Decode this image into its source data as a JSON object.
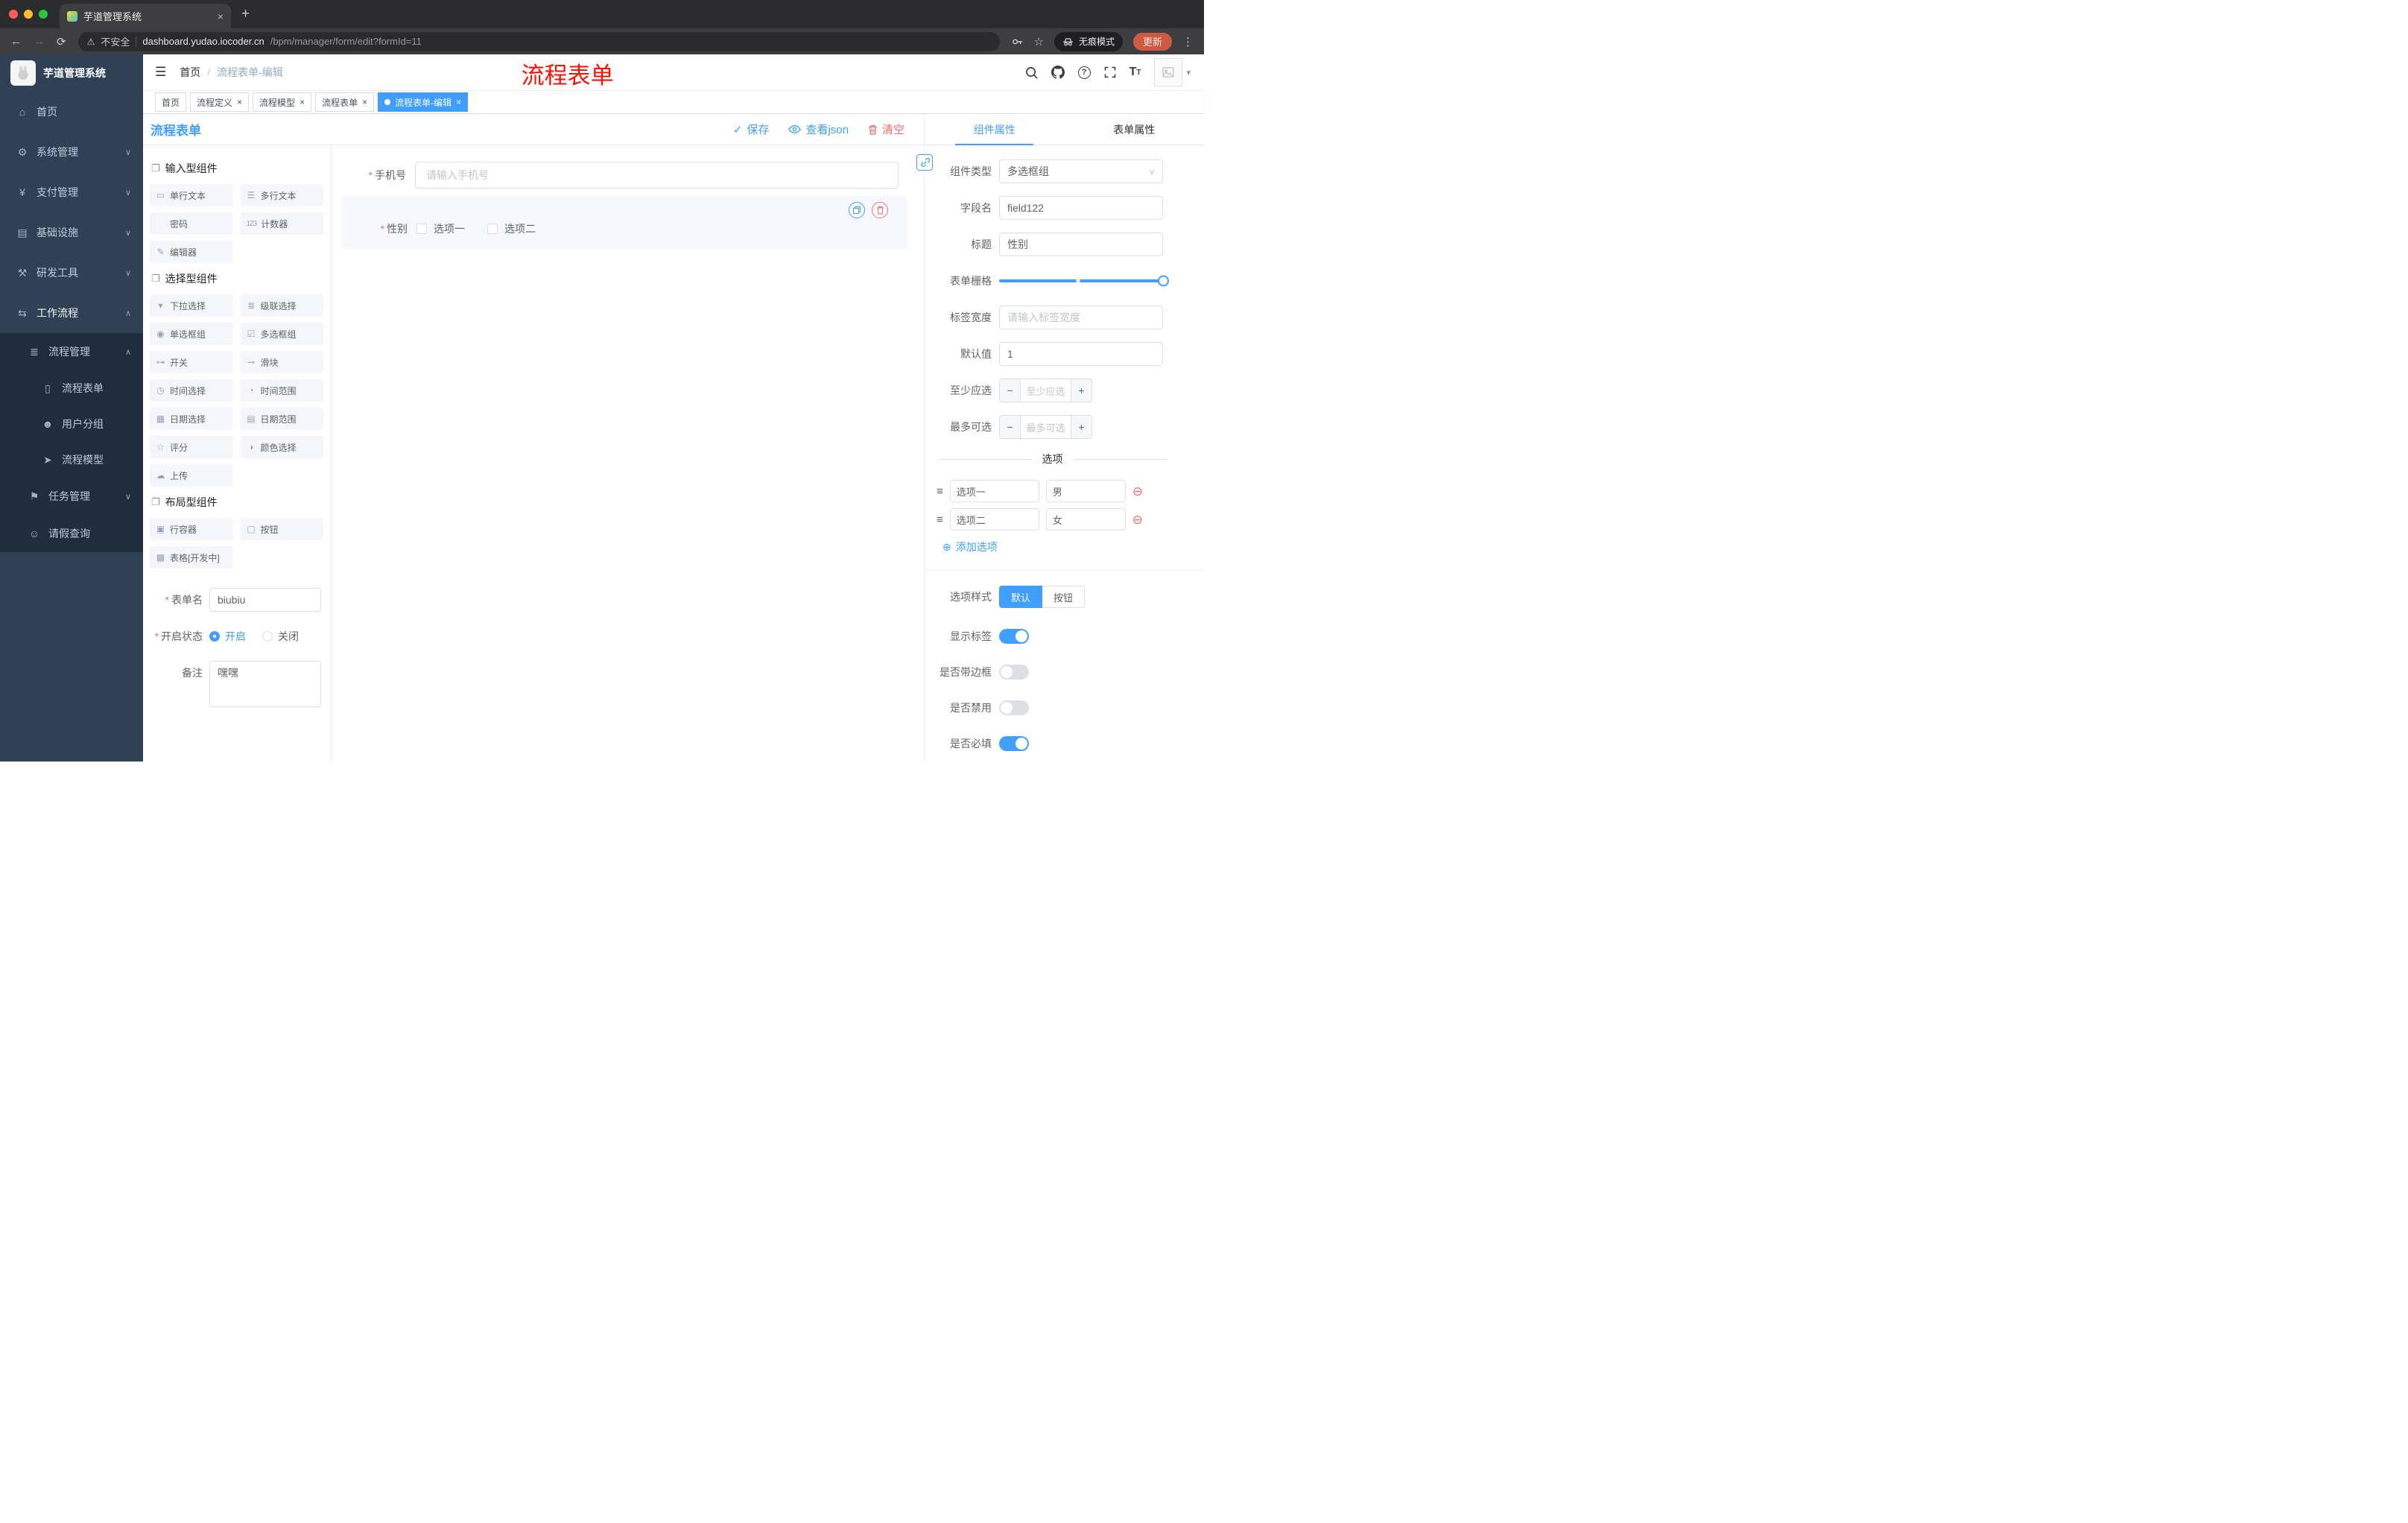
{
  "colors": {
    "accent": "#409eff",
    "danger": "#f56c6c",
    "annotation_red": "#fe1000",
    "sidebar_bg": "#304156",
    "submenu_bg": "#1f2d3d"
  },
  "icons": {
    "back": "←",
    "forward": "→",
    "reload": "⟳",
    "warning": "⚠",
    "star": "☆",
    "dots": "⋮",
    "hamburger": "☰",
    "caret_down": "∨",
    "caret_up": "∧",
    "select_caret": "∨",
    "avatar_caret": "▾",
    "close": "×",
    "new_tab": "+",
    "plus": "+",
    "minus": "−",
    "check": "✓",
    "add_circle": "⊕",
    "remove_circle": "⊖",
    "drag": "≡",
    "required": "*",
    "help": "?",
    "font_size_big": "T",
    "font_size_small": "T"
  },
  "browser": {
    "tab_title": "芋道管理系统",
    "security_label": "不安全",
    "url_domain": "dashboard.yudao.iocoder.cn",
    "url_path": "/bpm/manager/form/edit?formId=11",
    "incognito_label": "无痕模式",
    "update_label": "更新"
  },
  "sidebar": {
    "brand": "芋道管理系统",
    "items": [
      {
        "label": "首页",
        "icon": "⌂"
      },
      {
        "label": "系统管理",
        "icon": "⚙",
        "chevron": "∨"
      },
      {
        "label": "支付管理",
        "icon": "¥",
        "chevron": "∨"
      },
      {
        "label": "基础设施",
        "icon": "▤",
        "chevron": "∨"
      },
      {
        "label": "研发工具",
        "icon": "⚒",
        "chevron": "∨"
      },
      {
        "label": "工作流程",
        "icon": "⇆",
        "chevron": "∧"
      }
    ],
    "submenu": {
      "parent": {
        "label": "流程管理",
        "icon": "≣",
        "chevron": "∧"
      },
      "children": [
        {
          "label": "流程表单",
          "icon": "▯"
        },
        {
          "label": "用户分组",
          "icon": "☻"
        },
        {
          "label": "流程模型",
          "icon": "➤"
        }
      ],
      "siblings": [
        {
          "label": "任务管理",
          "icon": "⚑",
          "chevron": "∨"
        },
        {
          "label": "请假查询",
          "icon": "☺"
        }
      ]
    }
  },
  "header": {
    "breadcrumb_home": "首页",
    "breadcrumb_sep": "/",
    "breadcrumb_current": "流程表单-编辑",
    "annotation": "流程表单"
  },
  "tags": [
    {
      "label": "首页"
    },
    {
      "label": "流程定义"
    },
    {
      "label": "流程模型"
    },
    {
      "label": "流程表单"
    },
    {
      "label": "流程表单-编辑"
    }
  ],
  "designer": {
    "title": "流程表单",
    "save": "保存",
    "view_json": "查看json",
    "clear": "清空"
  },
  "palette": {
    "groups": [
      {
        "title": "输入型组件",
        "items": [
          {
            "label": "单行文本",
            "icon": "▭"
          },
          {
            "label": "多行文本",
            "icon": "☰"
          },
          {
            "label": "密码",
            "icon": "✱"
          },
          {
            "label": "计数器",
            "icon": "123"
          },
          {
            "label": "编辑器",
            "icon": "✎"
          }
        ]
      },
      {
        "title": "选择型组件",
        "items": [
          {
            "label": "下拉选择",
            "icon": "▾"
          },
          {
            "label": "级联选择",
            "icon": "≣"
          },
          {
            "label": "单选框组",
            "icon": "◉"
          },
          {
            "label": "多选框组",
            "icon": "☑"
          },
          {
            "label": "开关",
            "icon": "⊶"
          },
          {
            "label": "滑块",
            "icon": "⊸"
          },
          {
            "label": "时间选择",
            "icon": "◷"
          },
          {
            "label": "时间范围",
            "icon": "◔"
          },
          {
            "label": "日期选择",
            "icon": "▦"
          },
          {
            "label": "日期范围",
            "icon": "▤"
          },
          {
            "label": "评分",
            "icon": "☆"
          },
          {
            "label": "颜色选择",
            "icon": "◑"
          },
          {
            "label": "上传",
            "icon": "☁"
          }
        ]
      },
      {
        "title": "布局型组件",
        "items": [
          {
            "label": "行容器",
            "icon": "▣"
          },
          {
            "label": "按钮",
            "icon": "▢"
          },
          {
            "label": "表格[开发中]",
            "icon": "▩"
          }
        ]
      }
    ],
    "form": {
      "name_label": "表单名",
      "name_value": "biubiu",
      "status_label": "开启状态",
      "status_on": "开启",
      "status_off": "关闭",
      "remark_label": "备注",
      "remark_value": "嘿嘿"
    }
  },
  "canvas": {
    "phone_label": "手机号",
    "phone_placeholder": "请输入手机号",
    "gender_label": "性别",
    "gender_option1": "选项一",
    "gender_option2": "选项二"
  },
  "props": {
    "tab_component": "组件属性",
    "tab_form": "表单属性",
    "component_type_label": "组件类型",
    "component_type_value": "多选框组",
    "field_name_label": "字段名",
    "field_name_value": "field122",
    "title_label": "标题",
    "title_value": "性别",
    "grid_label": "表单栅格",
    "label_width_label": "标签宽度",
    "label_width_placeholder": "请输入标签宽度",
    "default_label": "默认值",
    "default_value": "1",
    "min_label": "至少应选",
    "min_placeholder": "至少应选",
    "max_label": "最多可选",
    "max_placeholder": "最多可选",
    "options_title": "选项",
    "options": [
      {
        "label": "选项一",
        "value": "男"
      },
      {
        "label": "选项二",
        "value": "女"
      }
    ],
    "add_option": "添加选项",
    "style_label": "选项样式",
    "style_default": "默认",
    "style_button": "按钮",
    "show_label": "显示标签",
    "border_label": "是否带边框",
    "disabled_label": "是否禁用",
    "required_label": "是否必填"
  }
}
